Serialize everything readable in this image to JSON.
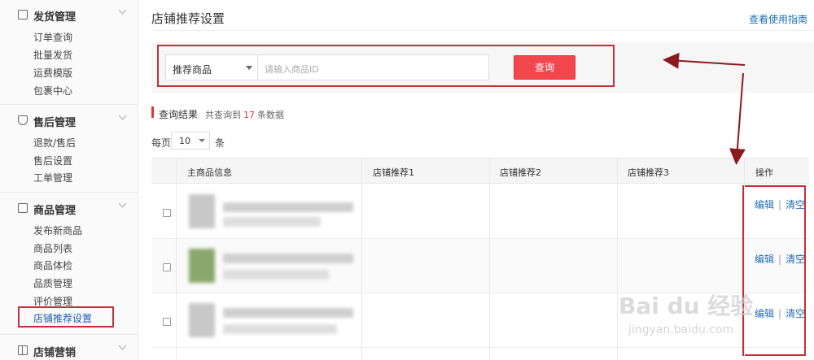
{
  "sidebar": {
    "groups": [
      {
        "title": "发货管理",
        "icon": "document-icon",
        "items": [
          "订单查询",
          "批量发货",
          "运费模版",
          "包裹中心"
        ]
      },
      {
        "title": "售后管理",
        "icon": "shield-icon",
        "items": [
          "退款/售后",
          "售后设置",
          "工单管理"
        ]
      },
      {
        "title": "商品管理",
        "icon": "box-icon",
        "items": [
          "发布新商品",
          "商品列表",
          "商品体检",
          "品质管理",
          "评价管理",
          "店铺推荐设置"
        ]
      },
      {
        "title": "店铺营销",
        "icon": "gift-icon",
        "items": []
      }
    ],
    "active_item": "店铺推荐设置"
  },
  "header": {
    "title": "店铺推荐设置",
    "guide_link": "查看使用指南"
  },
  "search": {
    "select_value": "推荐商品",
    "input_placeholder": "请输入商品ID",
    "button_label": "查询"
  },
  "results": {
    "title": "查询结果",
    "count_prefix": "共查询到",
    "count": "17",
    "count_suffix": "条数据"
  },
  "pagination": {
    "per_page_label": "每页",
    "per_page_value": "10",
    "per_page_unit": "条"
  },
  "table": {
    "columns": [
      "主商品信息",
      "店铺推荐1",
      "店铺推荐2",
      "店铺推荐3",
      "操作"
    ],
    "rows": [
      {
        "edit": "编辑",
        "clear": "清空"
      },
      {
        "edit": "编辑",
        "clear": "清空"
      },
      {
        "edit": "编辑",
        "clear": "清空"
      }
    ]
  },
  "watermark": {
    "main": "Bai du 经验",
    "sub": "jingyan.baidu.com"
  },
  "colors": {
    "accent_red": "#f2474d",
    "highlight_border": "#c0303b",
    "link_blue": "#1f6fb5"
  }
}
